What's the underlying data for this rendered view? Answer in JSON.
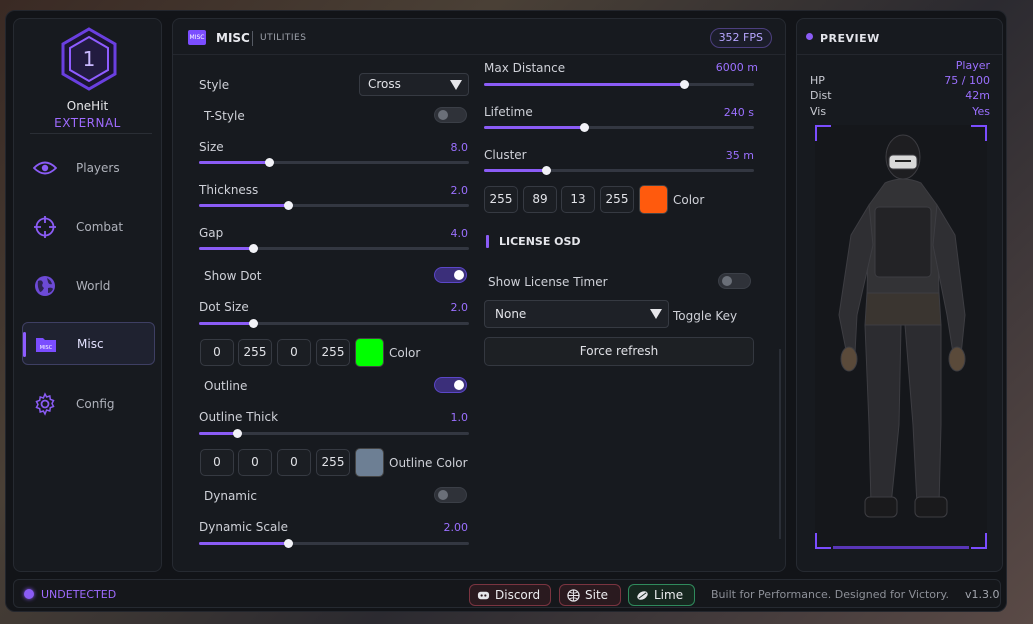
{
  "brand": {
    "logo_digit": "1",
    "name": "OneHit",
    "mode": "EXTERNAL"
  },
  "nav": [
    {
      "label": "Players",
      "icon": "eye-icon"
    },
    {
      "label": "Combat",
      "icon": "crosshair-icon"
    },
    {
      "label": "World",
      "icon": "globe-icon"
    },
    {
      "label": "Misc",
      "icon": "misc-folder-icon",
      "active": true
    },
    {
      "label": "Config",
      "icon": "gear-icon"
    }
  ],
  "header": {
    "icon_text": "MISC",
    "title": "MISC",
    "subtitle": "UTILITIES",
    "fps": "352 FPS"
  },
  "crosshair": {
    "style": {
      "label": "Style",
      "value": "Cross"
    },
    "t_style": {
      "label": "T-Style",
      "on": false
    },
    "size": {
      "label": "Size",
      "value": "8.0",
      "fraction": 0.26
    },
    "thickness": {
      "label": "Thickness",
      "value": "2.0",
      "fraction": 0.33
    },
    "gap": {
      "label": "Gap",
      "value": "4.0",
      "fraction": 0.2
    },
    "show_dot": {
      "label": "Show Dot",
      "on": true
    },
    "dot_size": {
      "label": "Dot Size",
      "value": "2.0",
      "fraction": 0.2
    },
    "dot_color": {
      "r": "0",
      "g": "255",
      "b": "0",
      "a": "255",
      "label": "Color",
      "hex": "#00ff00"
    },
    "outline": {
      "label": "Outline",
      "on": true
    },
    "outline_thick": {
      "label": "Outline Thick",
      "value": "1.0",
      "fraction": 0.14
    },
    "outline_color": {
      "r": "0",
      "g": "0",
      "b": "0",
      "a": "255",
      "label": "Outline Color",
      "hex": "#6d7f94"
    },
    "dynamic": {
      "label": "Dynamic",
      "on": false
    },
    "dynamic_scale": {
      "label": "Dynamic Scale",
      "value": "2.00",
      "fraction": 0.33
    }
  },
  "world": {
    "max_distance": {
      "label": "Max Distance",
      "value": "6000 m",
      "fraction": 0.74
    },
    "lifetime": {
      "label": "Lifetime",
      "value": "240 s",
      "fraction": 0.37
    },
    "cluster": {
      "label": "Cluster",
      "value": "35 m",
      "fraction": 0.23
    },
    "color": {
      "r": "255",
      "g": "89",
      "b": "13",
      "a": "255",
      "label": "Color",
      "hex": "#ff5a0d"
    }
  },
  "license": {
    "section_title": "LICENSE OSD",
    "show_timer": {
      "label": "Show License Timer",
      "on": false
    },
    "toggle_key": {
      "value": "None",
      "label": "Toggle Key"
    },
    "refresh_button": "Force refresh"
  },
  "preview": {
    "title": "PREVIEW",
    "name": "Player",
    "stats": [
      {
        "key": "HP",
        "value": "75 / 100"
      },
      {
        "key": "Dist",
        "value": "42m"
      },
      {
        "key": "Vis",
        "value": "Yes"
      }
    ]
  },
  "footer": {
    "status": "UNDETECTED",
    "links": [
      {
        "label": "Discord",
        "color": "#e0626b"
      },
      {
        "label": "Site",
        "color": "#d95b6c"
      },
      {
        "label": "Lime",
        "color": "#4fd18a"
      }
    ],
    "tagline": "Built for Performance. Designed for Victory.",
    "version": "v1.3.0"
  },
  "colors": {
    "accent": "#8b5cf6",
    "background": "#121418",
    "panel": "#171a1f"
  }
}
